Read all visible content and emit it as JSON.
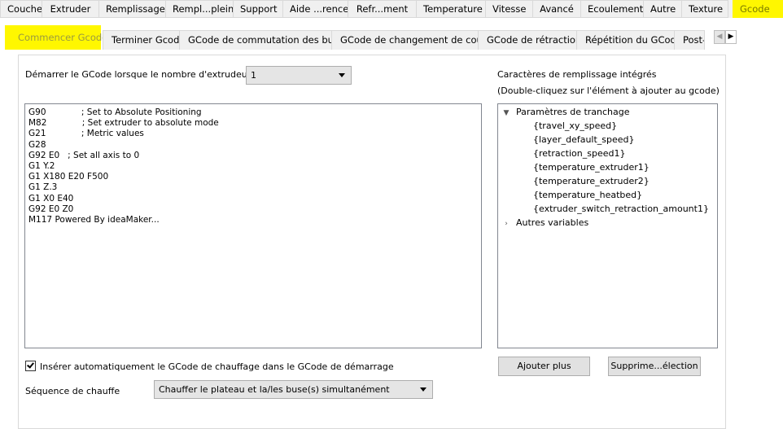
{
  "top_tabs": [
    "Couche",
    "Extruder",
    "Remplissage",
    "Rempl...plein",
    "Support",
    "Aide ...rence",
    "Refr...ment",
    "Temperature",
    "Vitesse",
    "Avancé",
    "Ecoulement",
    "Autre",
    "Texture",
    "Gcode"
  ],
  "top_tab_active": "Gcode",
  "sub_tabs": [
    "Commencer Gcode",
    "Terminer Gcode",
    "GCode de commutation des buses",
    "GCode de changement de couche",
    "GCode de rétraction",
    "Répétition du GCode",
    "Post-p"
  ],
  "sub_tab_active": "Commencer Gcode",
  "scroll": {
    "left": "◀",
    "right": "▶"
  },
  "extruder_count": {
    "label": "Démarrer le GCode lorsque le nombre d'extrudeur est",
    "value": "1"
  },
  "gcode_lines": [
    "G90             ; Set to Absolute Positioning",
    "M82             ; Set extruder to absolute mode",
    "G21             ; Metric values",
    "G28",
    "G92 E0   ; Set all axis to 0",
    "G1 Y.2",
    "G1 X180 E20 F500",
    "G1 Z.3",
    "G1 X0 E40",
    "G92 E0 Z0",
    "M117 Powered By ideaMaker..."
  ],
  "builtin": {
    "title": "Caractères de remplissage intégrés",
    "hint": "(Double-cliquez sur l'élément à ajouter au gcode)",
    "groups": [
      {
        "label": "Paramètres de tranchage",
        "expanded": true,
        "items": [
          "{travel_xy_speed}",
          "{layer_default_speed}",
          "{retraction_speed1}",
          "{temperature_extruder1}",
          "{temperature_extruder2}",
          "{temperature_heatbed}",
          "{extruder_switch_retraction_amount1}"
        ]
      },
      {
        "label": "Autres variables",
        "expanded": false,
        "items": []
      }
    ],
    "expanded_icon": "chevron-down-icon",
    "collapsed_icon": "chevron-right-icon"
  },
  "auto_heat": {
    "label": "Insérer automatiquement le GCode de chauffage dans le GCode de démarrage",
    "checked": true
  },
  "heat_sequence": {
    "label": "Séquence de chauffe",
    "value": "Chauffer le plateau et la/les buse(s) simultanément"
  },
  "buttons": {
    "add_more": "Ajouter plus",
    "delete_selection": "Supprime...élection"
  },
  "colors": {
    "highlight": "#fff700"
  }
}
